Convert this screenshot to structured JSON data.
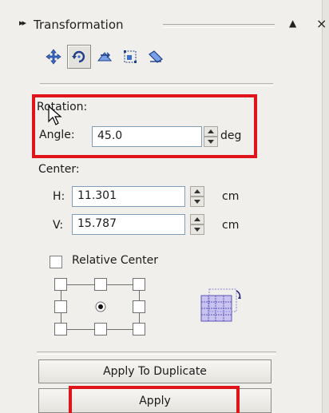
{
  "panel": {
    "title": "Transformation",
    "close_glyph": "×",
    "collapse_glyph": "▲",
    "grip_glyph": "▸▸"
  },
  "tools": [
    {
      "icon": "position-icon",
      "active": false
    },
    {
      "icon": "rotate-icon",
      "active": true
    },
    {
      "icon": "scale-mirror-icon",
      "active": false
    },
    {
      "icon": "size-icon",
      "active": false
    },
    {
      "icon": "skew-icon",
      "active": false
    }
  ],
  "rotation": {
    "section_label": "Rotation:",
    "angle_label": "Angle:",
    "angle_value": "45.0",
    "angle_unit": "deg"
  },
  "center": {
    "section_label": "Center:",
    "h_label": "H:",
    "h_value": "11.301",
    "h_unit": "cm",
    "v_label": "V:",
    "v_value": "15.787",
    "v_unit": "cm"
  },
  "relative_center": {
    "label": "Relative Center",
    "checked": false
  },
  "buttons": {
    "apply_to_duplicate": "Apply To Duplicate",
    "apply": "Apply"
  },
  "colors": {
    "highlight": "#e0141b",
    "field_border": "#7f9db9",
    "panel_bg": "#f0efeb"
  }
}
